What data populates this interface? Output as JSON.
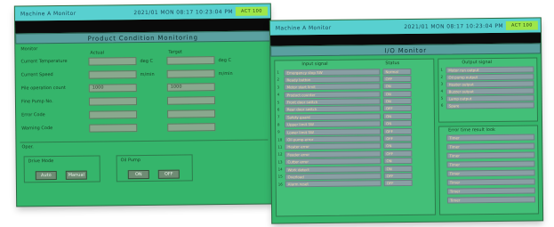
{
  "left_screen": {
    "status": {
      "left": "Machine A Monitor",
      "time": "2021/01 MON 08:17 10:23:04 PM",
      "badge": "ACT 100"
    },
    "title": "Product Condition Monitoring",
    "monitor_label": "Monitor",
    "col_actual": "Actual",
    "col_target": "Target",
    "rows": [
      {
        "label": "Current Temperature",
        "actual": "",
        "unit_actual": "deg C",
        "target": "",
        "unit_target": "deg C"
      },
      {
        "label": "Current Speed",
        "actual": "",
        "unit_actual": "m/min",
        "target": "",
        "unit_target": "m/min"
      },
      {
        "label": "Pile operation count",
        "actual": "1000",
        "unit_actual": "",
        "target": "1000",
        "unit_target": ""
      },
      {
        "label": "Fine Pump No.",
        "actual": "",
        "unit_actual": "",
        "target": "",
        "unit_target": ""
      },
      {
        "label": "Error Code",
        "actual": "",
        "unit_actual": "",
        "target": "",
        "unit_target": ""
      },
      {
        "label": "Warning Code",
        "actual": "",
        "unit_actual": "",
        "target": "",
        "unit_target": ""
      }
    ],
    "oper_label": "Oper.",
    "groups": [
      {
        "label": "Drive Mode",
        "btn1": "Auto",
        "btn2": "Manual"
      },
      {
        "label": "Oil Pump",
        "btn1": "ON",
        "btn2": "OFF"
      }
    ]
  },
  "right_screen": {
    "status": {
      "left": "Machine A Monitor",
      "time": "2021/01 MON 08:17 10:23:04 PM",
      "badge": "ACT 100"
    },
    "title": "I/O Monitor",
    "input_header": "Input signal",
    "status_header": "Status",
    "inputs": [
      {
        "n": "1",
        "name": "Emergency stop SW",
        "state": "Normal"
      },
      {
        "n": "2",
        "name": "Ready button",
        "state": "OFF"
      },
      {
        "n": "3",
        "name": "Motor start limit",
        "state": "ON"
      },
      {
        "n": "4",
        "name": "Product counter",
        "state": "ON"
      },
      {
        "n": "5",
        "name": "Front door switch",
        "state": "ON"
      },
      {
        "n": "6",
        "name": "Rear door switch",
        "state": "OFF"
      },
      {
        "n": "7",
        "name": "Safety guard",
        "state": "ON"
      },
      {
        "n": "8",
        "name": "Upper limit SW",
        "state": "ON"
      },
      {
        "n": "9",
        "name": "Lower limit SW",
        "state": "OFF"
      },
      {
        "n": "10",
        "name": "Oil pump error",
        "state": "OFF"
      },
      {
        "n": "11",
        "name": "Heater error",
        "state": "ON"
      },
      {
        "n": "12",
        "name": "Feeder error",
        "state": "OFF"
      },
      {
        "n": "13",
        "name": "Cutter error",
        "state": "ON"
      },
      {
        "n": "14",
        "name": "Work detect",
        "state": "ON"
      },
      {
        "n": "15",
        "name": "Overload",
        "state": "OFF"
      },
      {
        "n": "16",
        "name": "Alarm reset",
        "state": "OFF"
      }
    ],
    "output_header": "Output signal",
    "outputs": [
      {
        "n": "1",
        "name": "Motor run output"
      },
      {
        "n": "2",
        "name": "Oil pump output"
      },
      {
        "n": "3",
        "name": "Heater output"
      },
      {
        "n": "4",
        "name": "Buzzer output"
      },
      {
        "n": "5",
        "name": "Lamp output"
      },
      {
        "n": "6",
        "name": "Spare"
      }
    ],
    "error_header": "Error time result look",
    "errors": [
      "Timer",
      "Timer",
      "Timer",
      "Timer",
      "Timer",
      "Timer",
      "Timer",
      "Timer"
    ]
  }
}
